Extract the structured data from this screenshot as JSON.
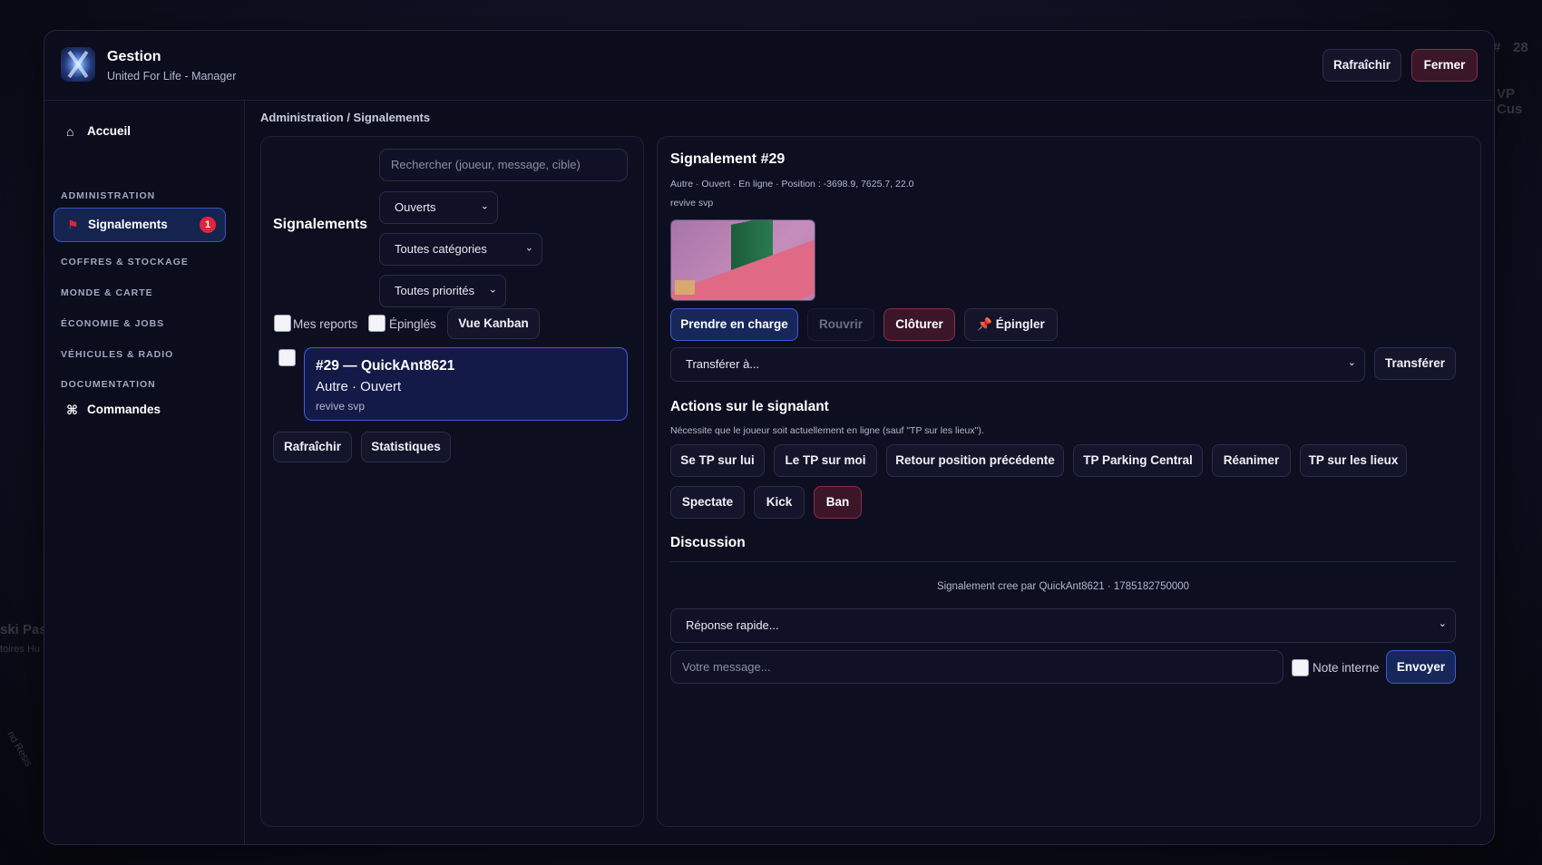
{
  "background": {
    "right_top_hash": "#",
    "right_top_num": "28",
    "right_top_text": "VP Cus",
    "left_mid_text": "ski Pas",
    "left_mid_sub": "toires Hu",
    "left_low_text": "nd Resis"
  },
  "header": {
    "title": "Gestion",
    "subtitle": "United For Life - Manager",
    "refresh_label": "Rafraîchir",
    "close_label": "Fermer"
  },
  "sidebar": {
    "home_label": "Accueil",
    "home_icon": "home-icon",
    "section_admin": "ADMINISTRATION",
    "reports_label": "Signalements",
    "reports_badge": "1",
    "reports_icon": "flag-icon",
    "section_chests": "COFFRES & STOCKAGE",
    "section_world": "MONDE & CARTE",
    "section_economy": "ÉCONOMIE & JOBS",
    "section_vehicles": "VÉHICULES & RADIO",
    "section_docs": "DOCUMENTATION",
    "commands_label": "Commandes",
    "commands_icon": "command-icon"
  },
  "breadcrumb": "Administration / Signalements",
  "list_panel": {
    "title": "Signalements",
    "search_placeholder": "Rechercher (joueur, message, cible)",
    "status_filter": "Ouverts",
    "category_filter": "Toutes catégories",
    "priority_filter": "Toutes priorités",
    "my_reports_label": "Mes reports",
    "pinned_label": "Épinglés",
    "kanban_label": "Vue Kanban",
    "reports": [
      {
        "title": "#29 — QuickAnt8621",
        "status": "Autre · Ouvert",
        "message": "revive svp"
      }
    ],
    "refresh_label": "Rafraîchir",
    "stats_label": "Statistiques"
  },
  "detail": {
    "title": "Signalement #29",
    "meta": "Autre · Ouvert · En ligne · Position : -3698.9, 7625.7, 22.0",
    "message": "revive svp",
    "take_label": "Prendre en charge",
    "reopen_label": "Rouvrir",
    "close_label": "Clôturer",
    "pin_label": "Épingler",
    "pin_icon": "pushpin-icon",
    "transfer_placeholder": "Transférer à...",
    "transfer_label": "Transférer",
    "actions_title": "Actions sur le signalant",
    "actions_note": "Nécessite que le joueur soit actuellement en ligne (sauf \"TP sur les lieux\").",
    "actions": [
      "Se TP sur lui",
      "Le TP sur moi",
      "Retour position précédente",
      "TP Parking Central",
      "Réanimer",
      "TP sur les lieux",
      "Spectate",
      "Kick",
      "Ban"
    ],
    "discussion_title": "Discussion",
    "discussion_event": "Signalement cree par QuickAnt8621 · 1785182750000",
    "quick_reply": "Réponse rapide...",
    "message_placeholder": "Votre message...",
    "internal_note_label": "Note interne",
    "send_label": "Envoyer"
  },
  "colors": {
    "accent_blue": "#3b5bd6",
    "danger": "#8a2c4b",
    "badge": "#e0243a",
    "panel_bg": "#0b0c1c"
  }
}
